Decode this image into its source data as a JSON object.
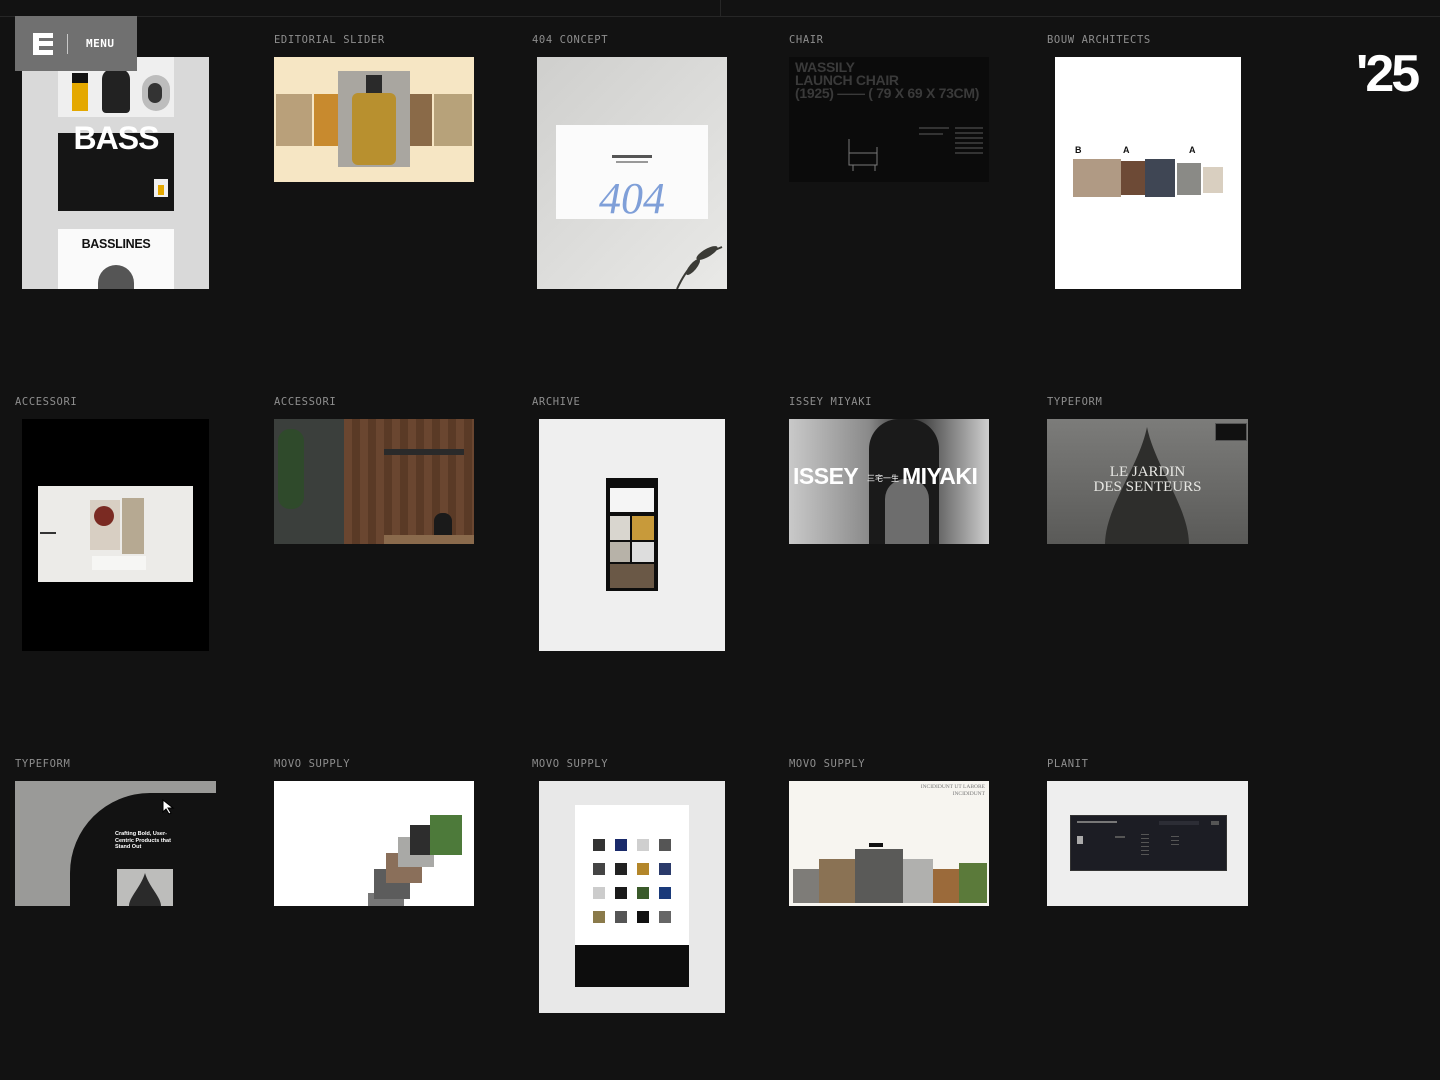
{
  "menu": {
    "label": "MENU"
  },
  "year": "'25",
  "projects": [
    {
      "label": "",
      "thumb": {
        "title_top": "BASS",
        "title_bottom": "BASSLINES"
      }
    },
    {
      "label": "EDITORIAL SLIDER"
    },
    {
      "label": "404 CONCEPT",
      "thumb": {
        "code": "404"
      }
    },
    {
      "label": "CHAIR",
      "thumb": {
        "line1": "WASSILY",
        "line2": "LAUNCH CHAIR",
        "line3": "(1925) —— ( 79 X 69 X 73CM)"
      }
    },
    {
      "label": "BOUW ARCHITECTS",
      "thumb": {
        "letters": [
          "B",
          "A",
          "A"
        ]
      }
    },
    {
      "label": "ACCESSORI"
    },
    {
      "label": "ACCESSORI"
    },
    {
      "label": "ARCHIVE"
    },
    {
      "label": "ISSEY MIYAKI",
      "thumb": {
        "left": "ISSEY",
        "right": "MIYAKI",
        "mark": "三宅一生"
      }
    },
    {
      "label": "TYPEFORM",
      "thumb": {
        "line1": "LE JARDIN",
        "line2": "DES SENTEURS"
      }
    },
    {
      "label": "TYPEFORM",
      "thumb": {
        "headline": "Crafting Bold, User-Centric Products that Stand Out"
      }
    },
    {
      "label": "MOVO SUPPLY"
    },
    {
      "label": "MOVO SUPPLY"
    },
    {
      "label": "MOVO SUPPLY",
      "thumb": {
        "heading": "INCIDIDUNT UT LABORE INCIDIDUNT"
      }
    },
    {
      "label": "PLANIT"
    }
  ],
  "colors": {
    "background": "#121212",
    "menu_box": "#707070",
    "label": "#8e8e8e"
  }
}
